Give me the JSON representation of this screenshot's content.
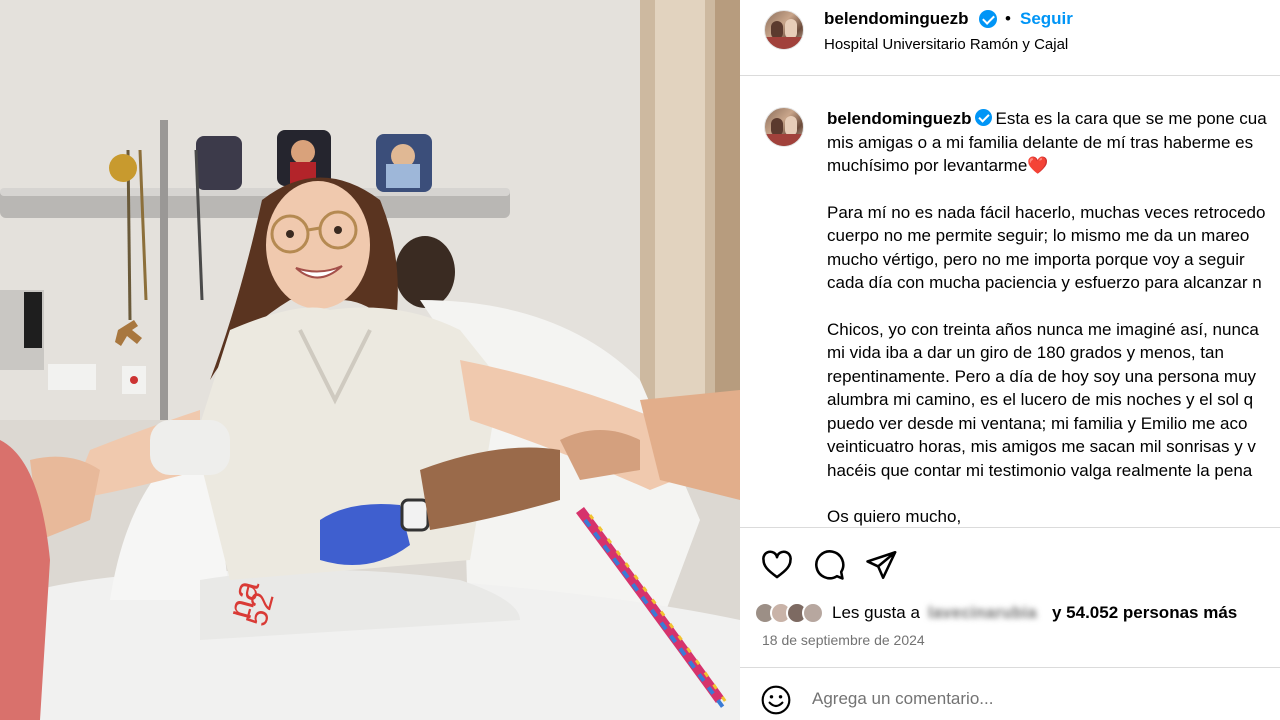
{
  "post": {
    "username": "belendominguezb",
    "follow_label": "Seguir",
    "separator": "•",
    "location": "Hospital Universitario Ramón y Cajal"
  },
  "caption": {
    "username": "belendominguezb",
    "line1": "Esta es la cara que se me pone cua",
    "line2": "mis amigas o a mi familia delante de mí tras haberme es",
    "line3": "muchísimo por levantarme",
    "heart": "❤️",
    "para2": "Para mí no es nada fácil hacerlo, muchas veces retrocedo\ncuerpo no me permite seguir; lo mismo me da un mareo\nmucho vértigo, pero no me importa porque voy a seguir\ncada día con mucha paciencia y esfuerzo para alcanzar n",
    "para3": "Chicos, yo con treinta años nunca me imaginé así, nunca\nmi vida iba a dar un giro de 180 grados y menos, tan\nrepentinamente. Pero a día de hoy soy una persona muy\nalumbra mi camino, es el lucero de mis noches y el sol q\npuedo ver desde mi ventana; mi familia y Emilio me aco\nveinticuatro horas, mis amigos me sacan mil sonrisas y v\nhacéis que contar mi testimonio valga realmente la pena",
    "para4": "Os quiero mucho,"
  },
  "actions": {
    "likes_prefix": "Les gusta a",
    "liker_name": "lavecinarubia",
    "likes_suffix": "y 54.052 personas más",
    "date": "18 de septiembre de 2024"
  },
  "comment": {
    "placeholder": "Agrega un comentario..."
  },
  "icons": {
    "like": "heart-outline-icon",
    "comment": "speech-bubble-icon",
    "share": "paper-plane-icon",
    "emoji": "smiley-icon",
    "verified": "verified-badge-icon"
  },
  "colors": {
    "accent": "#0095f6",
    "heart": "#e0102c",
    "muted": "#737373",
    "divider": "#dbdbdb"
  }
}
